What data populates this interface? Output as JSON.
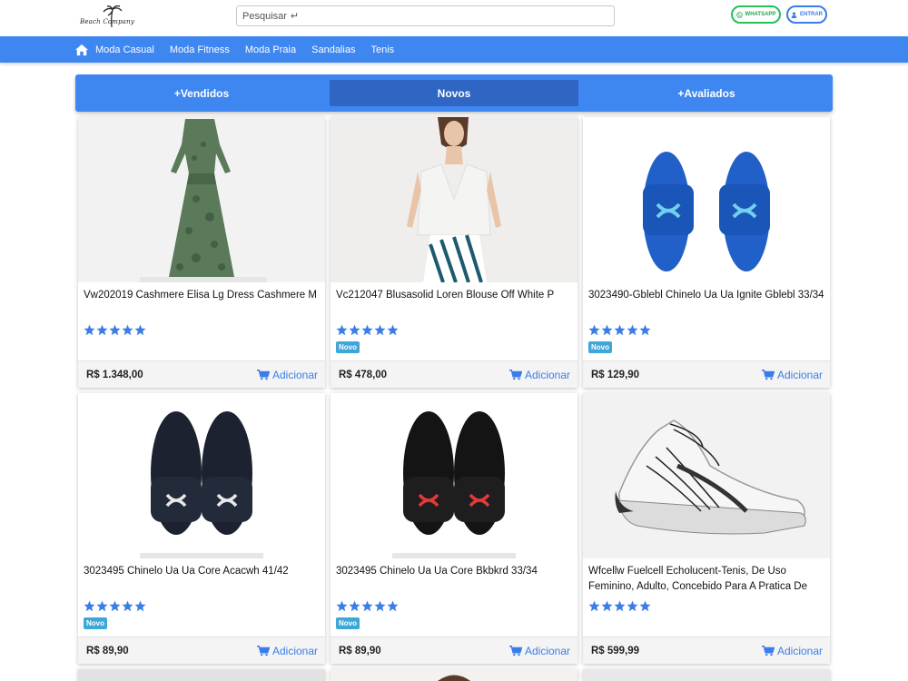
{
  "header": {
    "logo_text": "Beach Company",
    "search_placeholder": "Pesquisar",
    "search_enter_glyph": "↵",
    "whatsapp_label": "WHATSAPP",
    "login_label": "ENTRAR"
  },
  "nav": {
    "items": [
      "Moda Casual",
      "Moda Fitness",
      "Moda Praia",
      "Sandalias",
      "Tenis"
    ]
  },
  "tabs": {
    "items": [
      "+Vendidos",
      "Novos",
      "+Avaliados"
    ],
    "active": "Novos"
  },
  "colors": {
    "brand_blue": "#3e86f0",
    "active_tab": "#2f66c4",
    "badge": "#3fa6d8",
    "whatsapp_green": "#25c25a",
    "star": "#3b7de8"
  },
  "products": [
    {
      "title": "Vw202019 Cashmere Elisa Lg Dress Cashmere M",
      "rating": 5,
      "badge": "",
      "price": "R$ 1.348,00",
      "add_label": "Adicionar",
      "image": "dress-green-icon"
    },
    {
      "title": "Vc212047 Blusasolid Loren Blouse Off White P",
      "rating": 5,
      "badge": "Novo",
      "price": "R$ 478,00",
      "add_label": "Adicionar",
      "image": "blouse-white-icon"
    },
    {
      "title": "3023490-Gblebl Chinelo Ua Ua Ignite Gblebl 33/34",
      "rating": 5,
      "badge": "Novo",
      "price": "R$ 129,90",
      "add_label": "Adicionar",
      "image": "slides-blue-icon"
    },
    {
      "title": "3023495 Chinelo Ua Ua Core Acacwh 41/42",
      "rating": 5,
      "badge": "Novo",
      "price": "R$ 89,90",
      "add_label": "Adicionar",
      "image": "slides-navy-icon"
    },
    {
      "title": "3023495 Chinelo Ua Ua Core Bkbkrd 33/34",
      "rating": 5,
      "badge": "Novo",
      "price": "R$ 89,90",
      "add_label": "Adicionar",
      "image": "slides-black-red-icon"
    },
    {
      "title": "Wfcellw Fuelcell Echolucent-Tenis, De Uso Feminino, Adulto, Concebido Para A Pratica De",
      "rating": 5,
      "badge": "",
      "price": "R$ 599,99",
      "add_label": "Adicionar",
      "image": "sneaker-white-icon"
    }
  ]
}
